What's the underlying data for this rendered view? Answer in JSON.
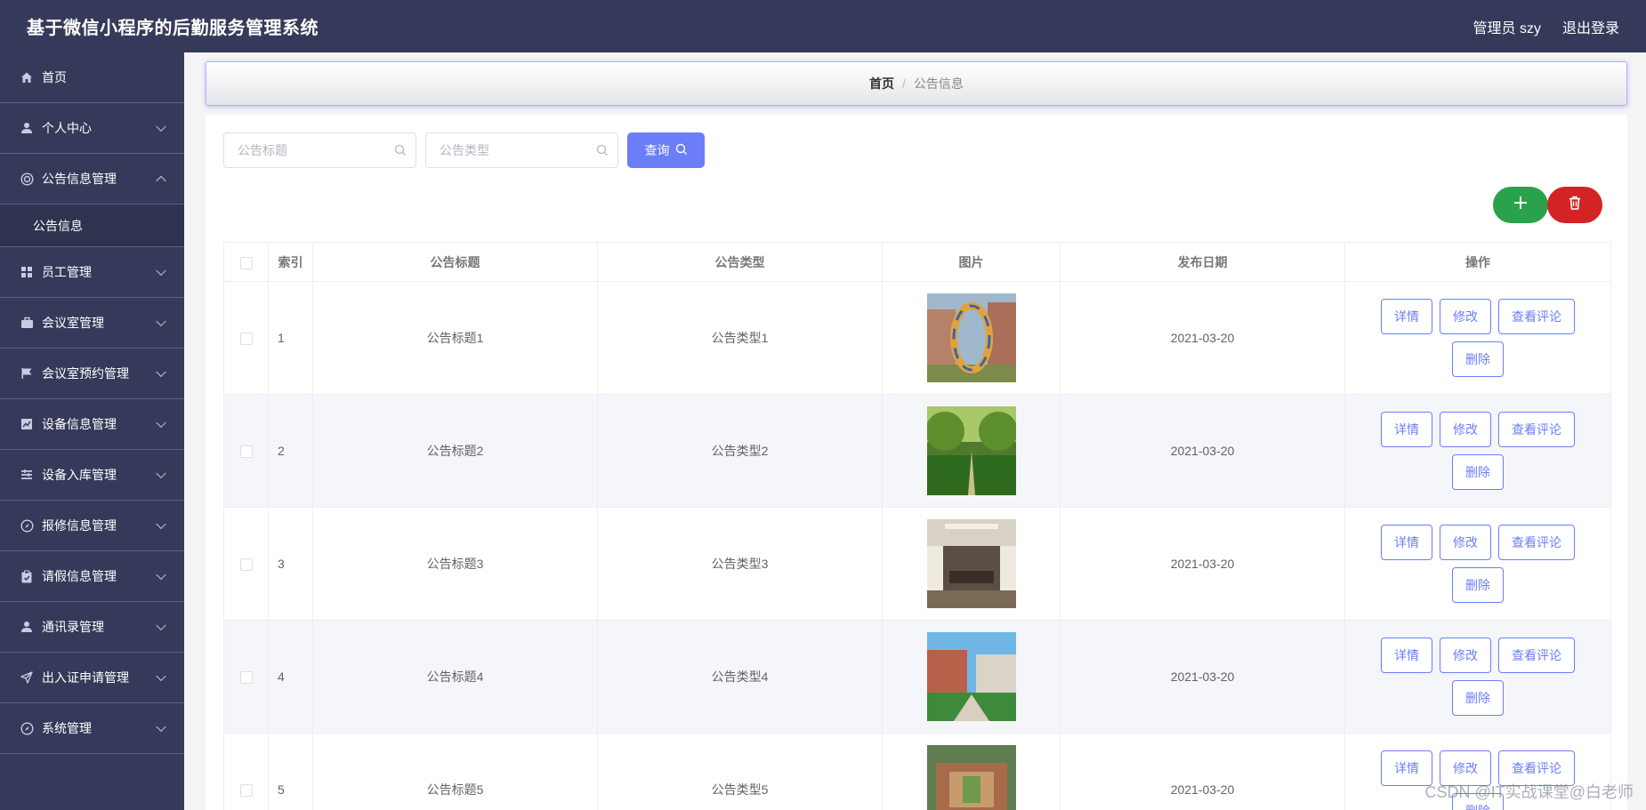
{
  "header": {
    "app_title": "基于微信小程序的后勤服务管理系统",
    "admin_label": "管理员 szy",
    "logout_label": "退出登录"
  },
  "sidebar": {
    "items": [
      {
        "label": "首页",
        "icon": "home-icon"
      },
      {
        "label": "个人中心",
        "icon": "user-icon"
      },
      {
        "label": "公告信息管理",
        "icon": "notice-icon",
        "expanded": true
      },
      {
        "label": "公告信息",
        "icon": "",
        "sub": true
      },
      {
        "label": "员工管理",
        "icon": "grid-icon"
      },
      {
        "label": "会议室管理",
        "icon": "briefcase-icon"
      },
      {
        "label": "会议室预约管理",
        "icon": "flag-icon"
      },
      {
        "label": "设备信息管理",
        "icon": "chart-icon"
      },
      {
        "label": "设备入库管理",
        "icon": "list-icon"
      },
      {
        "label": "报修信息管理",
        "icon": "compass-icon"
      },
      {
        "label": "请假信息管理",
        "icon": "clipboard-icon"
      },
      {
        "label": "通讯录管理",
        "icon": "user-icon"
      },
      {
        "label": "出入证申请管理",
        "icon": "send-icon"
      },
      {
        "label": "系统管理",
        "icon": "compass-icon"
      }
    ]
  },
  "breadcrumb": {
    "home": "首页",
    "separator": "/",
    "current": "公告信息"
  },
  "search": {
    "title_placeholder": "公告标题",
    "type_placeholder": "公告类型",
    "query_label": "查询"
  },
  "table": {
    "headers": {
      "index": "索引",
      "title": "公告标题",
      "type": "公告类型",
      "image": "图片",
      "date": "发布日期",
      "actions": "操作"
    },
    "rows": [
      {
        "index": "1",
        "title": "公告标题1",
        "type": "公告类型1",
        "date": "2021-03-20"
      },
      {
        "index": "2",
        "title": "公告标题2",
        "type": "公告类型2",
        "date": "2021-03-20"
      },
      {
        "index": "3",
        "title": "公告标题3",
        "type": "公告类型3",
        "date": "2021-03-20"
      },
      {
        "index": "4",
        "title": "公告标题4",
        "type": "公告类型4",
        "date": "2021-03-20"
      },
      {
        "index": "5",
        "title": "公告标题5",
        "type": "公告类型5",
        "date": "2021-03-20"
      }
    ],
    "actions": {
      "detail": "详情",
      "edit": "修改",
      "comments": "查看评论",
      "delete": "删除"
    }
  },
  "watermark": "CSDN @IT实战课堂@白老师",
  "colors": {
    "sidebar_bg": "#363a5a",
    "accent": "#6b7ef7",
    "add_green": "#29a34b",
    "delete_red": "#d42324"
  }
}
